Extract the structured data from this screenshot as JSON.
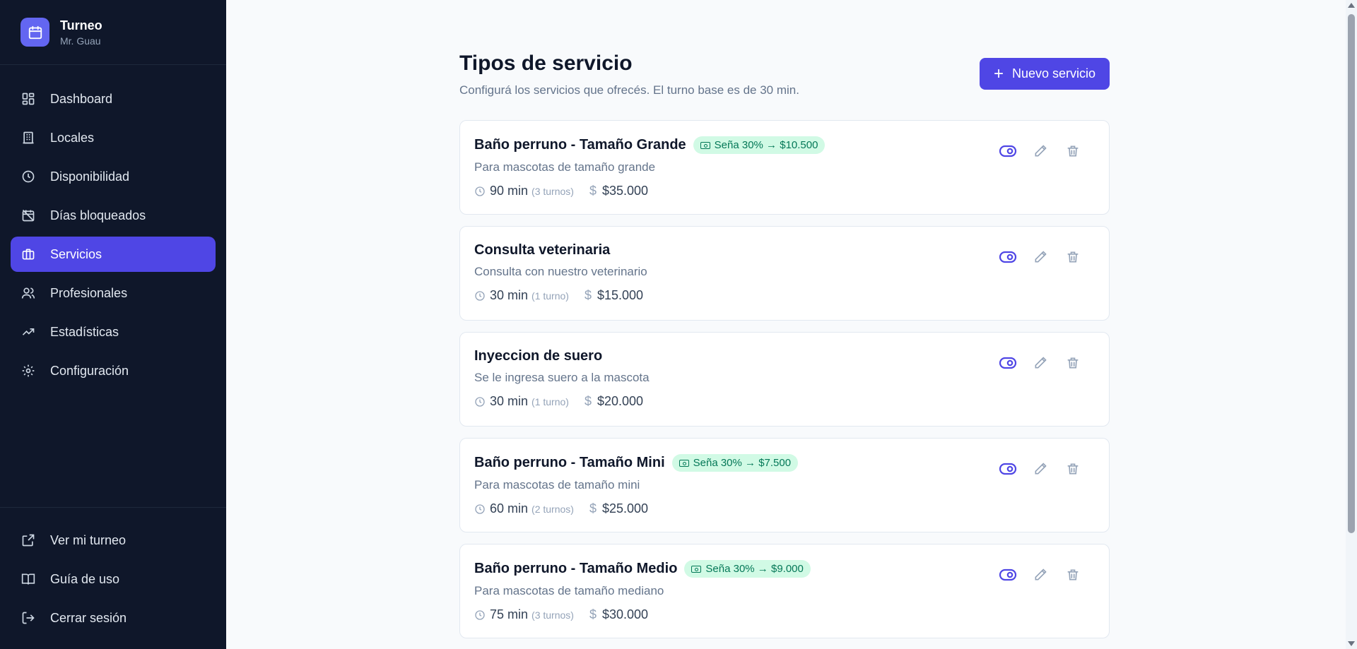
{
  "brand": {
    "title": "Turneo",
    "subtitle": "Mr. Guau"
  },
  "nav": [
    {
      "label": "Dashboard",
      "icon": "dashboard-icon",
      "active": false
    },
    {
      "label": "Locales",
      "icon": "building-icon",
      "active": false
    },
    {
      "label": "Disponibilidad",
      "icon": "clock-icon",
      "active": false
    },
    {
      "label": "Días bloqueados",
      "icon": "calendar-blocked-icon",
      "active": false
    },
    {
      "label": "Servicios",
      "icon": "briefcase-icon",
      "active": true
    },
    {
      "label": "Profesionales",
      "icon": "users-icon",
      "active": false
    },
    {
      "label": "Estadísticas",
      "icon": "trending-up-icon",
      "active": false
    },
    {
      "label": "Configuración",
      "icon": "gear-icon",
      "active": false
    }
  ],
  "bottom_nav": [
    {
      "label": "Ver mi turneo",
      "icon": "external-link-icon"
    },
    {
      "label": "Guía de uso",
      "icon": "book-icon"
    },
    {
      "label": "Cerrar sesión",
      "icon": "logout-icon"
    }
  ],
  "header": {
    "title": "Tipos de servicio",
    "subtitle": "Configurá los servicios que ofrecés. El turno base es de 30 min.",
    "new_button": "Nuevo servicio"
  },
  "services": [
    {
      "name": "Baño perruno - Tamaño Grande",
      "badge": "Seña 30% → $10.500",
      "description": "Para mascotas de tamaño grande",
      "duration": "90 min",
      "turnos": "(3 turnos)",
      "price": "$35.000"
    },
    {
      "name": "Consulta veterinaria",
      "badge": "",
      "description": "Consulta con nuestro veterinario",
      "duration": "30 min",
      "turnos": "(1 turno)",
      "price": "$15.000"
    },
    {
      "name": "Inyeccion de suero",
      "badge": "",
      "description": "Se le ingresa suero a la mascota",
      "duration": "30 min",
      "turnos": "(1 turno)",
      "price": "$20.000"
    },
    {
      "name": "Baño perruno - Tamaño Mini",
      "badge": "Seña 30% → $7.500",
      "description": "Para mascotas de tamaño mini",
      "duration": "60 min",
      "turnos": "(2 turnos)",
      "price": "$25.000"
    },
    {
      "name": "Baño perruno - Tamaño Medio",
      "badge": "Seña 30% → $9.000",
      "description": "Para mascotas de tamaño mediano",
      "duration": "75 min",
      "turnos": "(3 turnos)",
      "price": "$30.000"
    }
  ],
  "colors": {
    "accent": "#4f46e5",
    "sidebar": "#0f172a",
    "badge_bg": "#d1fae5",
    "badge_text": "#047857"
  }
}
